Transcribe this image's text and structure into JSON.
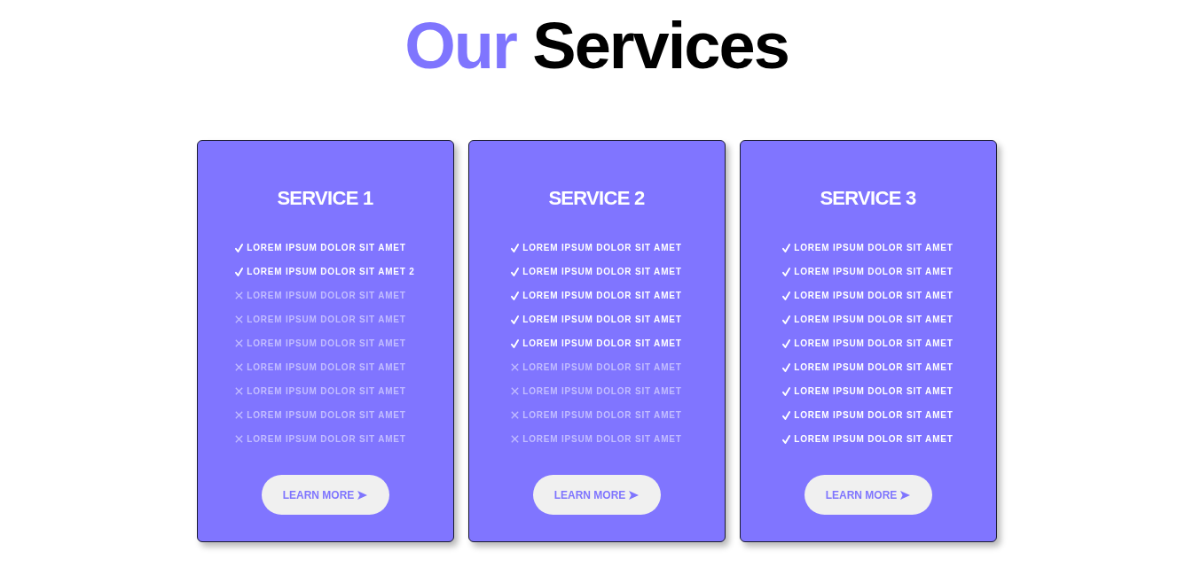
{
  "heading": {
    "highlight": "Our",
    "text": "Services"
  },
  "services": [
    {
      "title": "SERVICE 1",
      "features": [
        {
          "text": "LOREM IPSUM DOLOR SIT AMET",
          "included": true
        },
        {
          "text": "LOREM IPSUM DOLOR SIT AMET 2",
          "included": true
        },
        {
          "text": "LOREM IPSUM DOLOR SIT AMET",
          "included": false
        },
        {
          "text": "LOREM IPSUM DOLOR SIT AMET",
          "included": false
        },
        {
          "text": "LOREM IPSUM DOLOR SIT AMET",
          "included": false
        },
        {
          "text": "LOREM IPSUM DOLOR SIT AMET",
          "included": false
        },
        {
          "text": "LOREM IPSUM DOLOR SIT AMET",
          "included": false
        },
        {
          "text": "LOREM IPSUM DOLOR SIT AMET",
          "included": false
        },
        {
          "text": "LOREM IPSUM DOLOR SIT AMET",
          "included": false
        }
      ],
      "button": "LEARN MORE"
    },
    {
      "title": "SERVICE 2",
      "features": [
        {
          "text": "LOREM IPSUM DOLOR SIT AMET",
          "included": true
        },
        {
          "text": "LOREM IPSUM DOLOR SIT AMET",
          "included": true
        },
        {
          "text": "LOREM IPSUM DOLOR SIT AMET",
          "included": true
        },
        {
          "text": "LOREM IPSUM DOLOR SIT AMET",
          "included": true
        },
        {
          "text": "LOREM IPSUM DOLOR SIT AMET",
          "included": true
        },
        {
          "text": "LOREM IPSUM DOLOR SIT AMET",
          "included": false
        },
        {
          "text": "LOREM IPSUM DOLOR SIT AMET",
          "included": false
        },
        {
          "text": "LOREM IPSUM DOLOR SIT AMET",
          "included": false
        },
        {
          "text": "LOREM IPSUM DOLOR SIT AMET",
          "included": false
        }
      ],
      "button": "LEARN MORE"
    },
    {
      "title": "SERVICE 3",
      "features": [
        {
          "text": "LOREM IPSUM DOLOR SIT AMET",
          "included": true
        },
        {
          "text": "LOREM IPSUM DOLOR SIT AMET",
          "included": true
        },
        {
          "text": "LOREM IPSUM DOLOR SIT AMET",
          "included": true
        },
        {
          "text": "LOREM IPSUM DOLOR SIT AMET",
          "included": true
        },
        {
          "text": "LOREM IPSUM DOLOR SIT AMET",
          "included": true
        },
        {
          "text": "LOREM IPSUM DOLOR SIT AMET",
          "included": true
        },
        {
          "text": "LOREM IPSUM DOLOR SIT AMET",
          "included": true
        },
        {
          "text": "LOREM IPSUM DOLOR SIT AMET",
          "included": true
        },
        {
          "text": "LOREM IPSUM DOLOR SIT AMET",
          "included": true
        }
      ],
      "button": "LEARN MORE"
    }
  ]
}
